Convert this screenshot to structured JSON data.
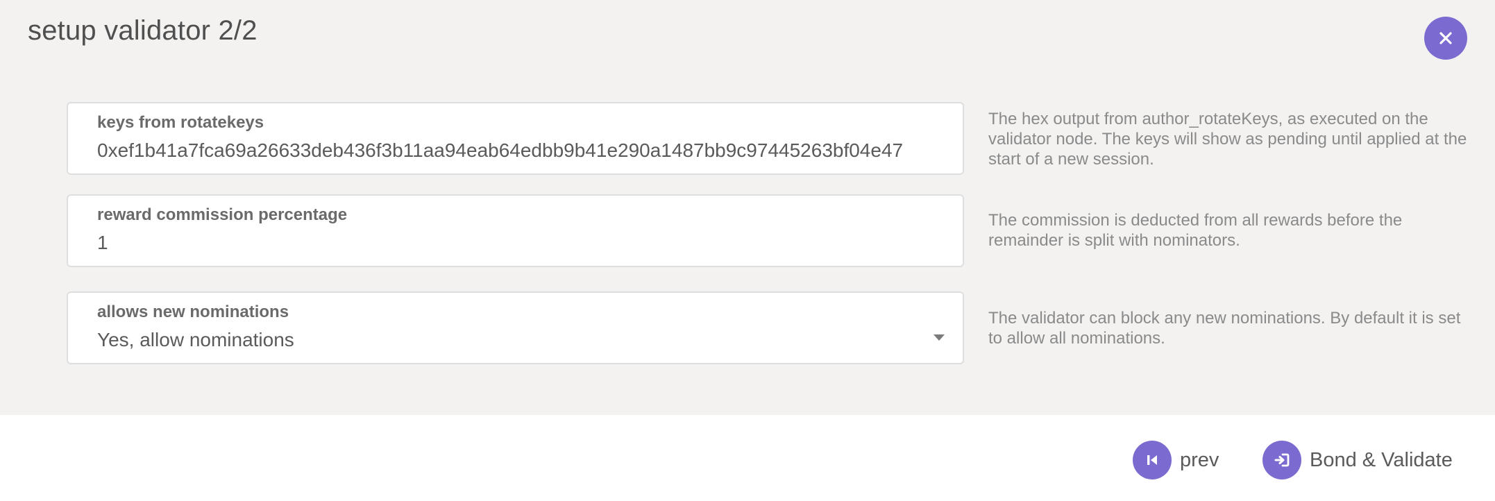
{
  "header": {
    "title": "setup validator 2/2",
    "close_icon": "close-icon"
  },
  "fields": {
    "keys": {
      "label": "keys from rotatekeys",
      "value": "0xef1b41a7fca69a26633deb436f3b11aa94eab64edbb9b41e290a1487bb9c97445263bf04e47",
      "help": "The hex output from author_rotateKeys, as executed on the validator node. The keys will show as pending until applied at the start of a new session."
    },
    "commission": {
      "label": "reward commission percentage",
      "value": "1",
      "help": "The commission is deducted from all rewards before the remainder is split with nominators."
    },
    "nominations": {
      "label": "allows new nominations",
      "selected": "Yes, allow nominations",
      "help": "The validator can block any new nominations. By default it is set to allow all nominations."
    }
  },
  "footer": {
    "prev_label": "prev",
    "prev_icon": "step-backward-icon",
    "submit_label": "Bond & Validate",
    "submit_icon": "sign-in-icon"
  },
  "colors": {
    "accent": "#7b6ad0",
    "content_bg": "#f3f2f1",
    "footer_bg": "#ffffff"
  }
}
